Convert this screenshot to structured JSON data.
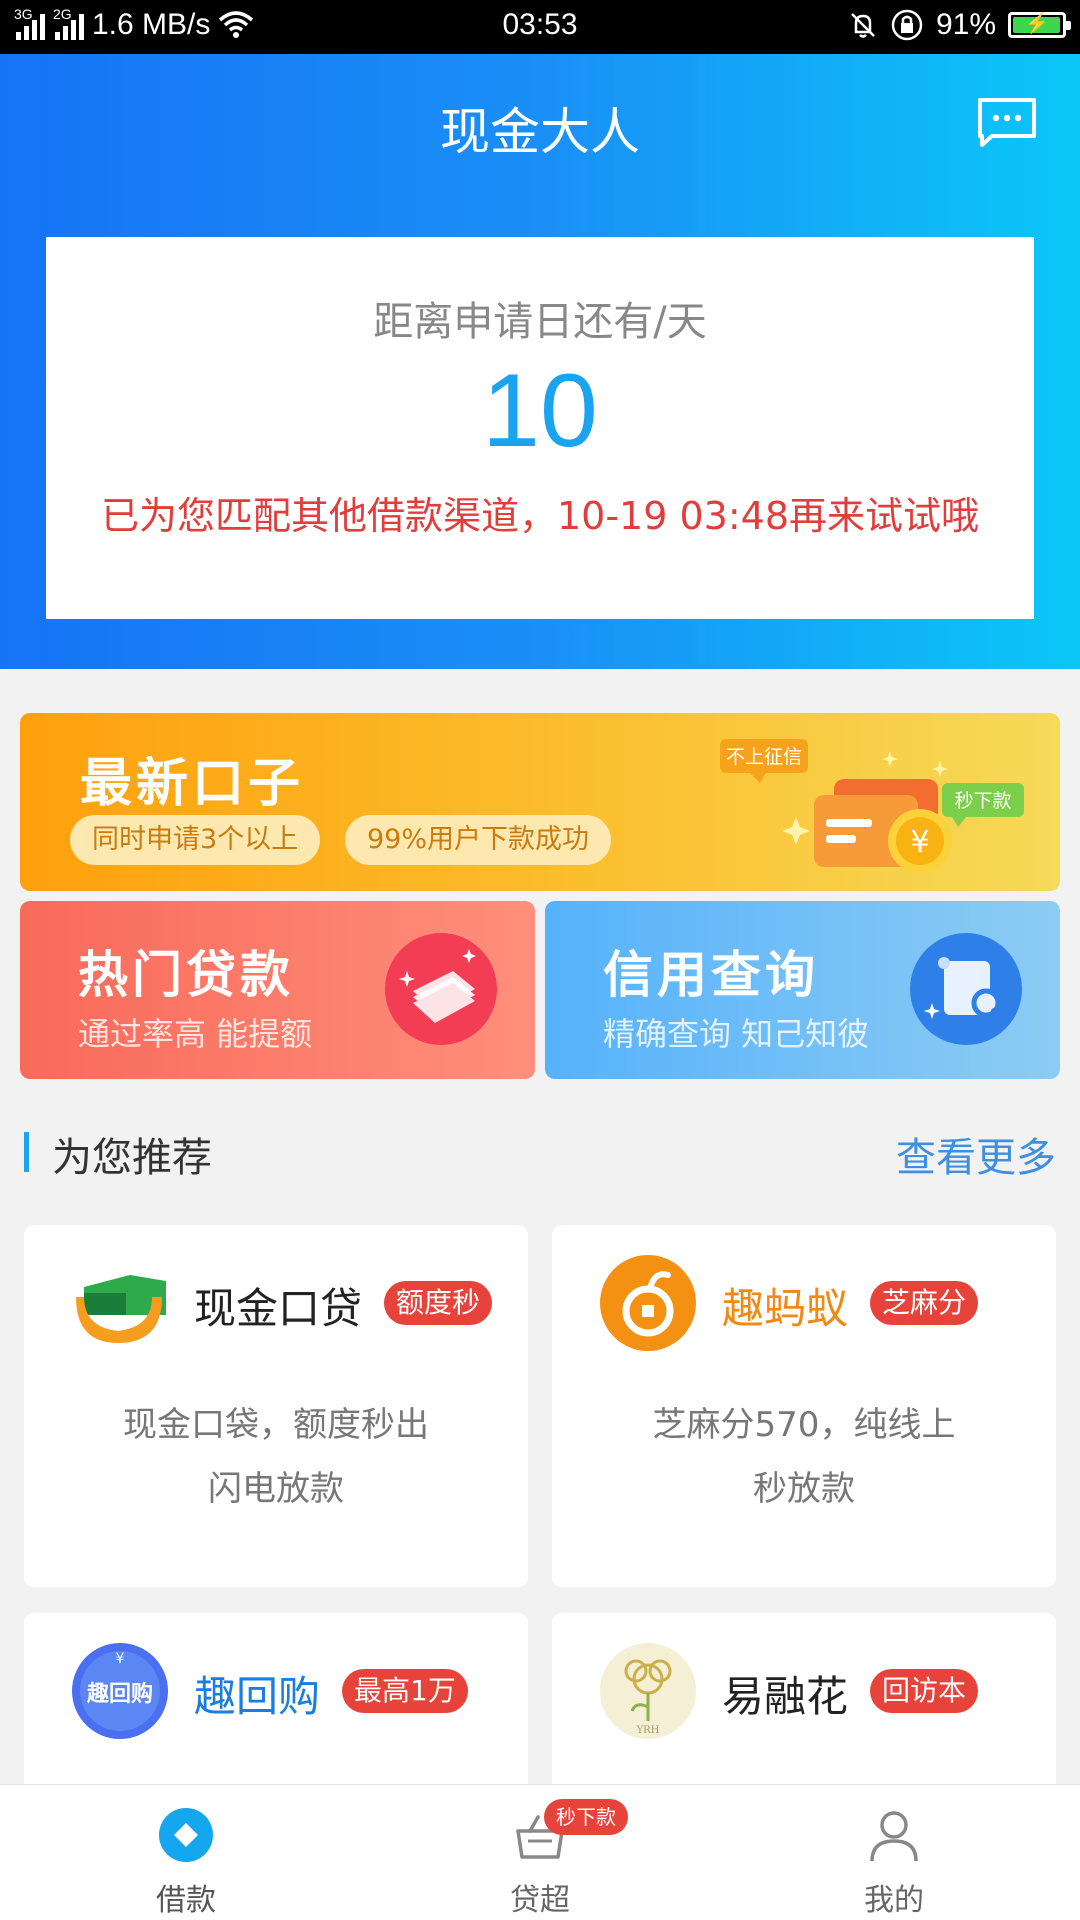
{
  "status_bar": {
    "network_1": "3G",
    "network_2": "2G",
    "speed": "1.6 MB/s",
    "time": "03:53",
    "battery_percent": "91%",
    "battery_level": 0.91
  },
  "header": {
    "title": "现金大人",
    "message_icon": "message-icon"
  },
  "countdown": {
    "label": "距离申请日还有/天",
    "days": "10",
    "message": "已为您匹配其他借款渠道，10-19 03:48再来试试哦"
  },
  "banners": {
    "main": {
      "title": "最新口子",
      "pill_1": "同时申请3个以上",
      "pill_2": "99%用户下款成功",
      "tag_left": "不上征信",
      "tag_right": "秒下款"
    },
    "hot": {
      "title": "热门贷款",
      "subtitle": "通过率高 能提额"
    },
    "credit": {
      "title": "信用查询",
      "subtitle": "精确查询 知己知彼"
    }
  },
  "recommend": {
    "title": "为您推荐",
    "more": "查看更多",
    "products": [
      {
        "name": "现金口贷",
        "tag": "额度秒",
        "desc_1": "现金口袋，额度秒出",
        "desc_2": "闪电放款",
        "name_color": "#222222"
      },
      {
        "name": "趣蚂蚁",
        "tag": "芝麻分",
        "desc_1": "芝麻分570，纯线上",
        "desc_2": "秒放款",
        "name_color": "#f08a12"
      },
      {
        "name": "趣回购",
        "tag": "最高1万",
        "logo_text": "趣回购",
        "name_color": "#1a7de0"
      },
      {
        "name": "易融花",
        "tag": "回访本",
        "logo_text": "YRH",
        "name_color": "#222222"
      }
    ]
  },
  "bottom_nav": {
    "items": [
      {
        "label": "借款",
        "icon": "loan-icon"
      },
      {
        "label": "贷超",
        "icon": "basket-icon",
        "badge": "秒下款"
      },
      {
        "label": "我的",
        "icon": "user-icon"
      }
    ]
  },
  "colors": {
    "header_gradient_start": "#1673f5",
    "header_gradient_end": "#0bc7f7",
    "accent_blue": "#1aa4f0",
    "alert_red": "#e23d3d",
    "tag_red": "#e8433b"
  }
}
